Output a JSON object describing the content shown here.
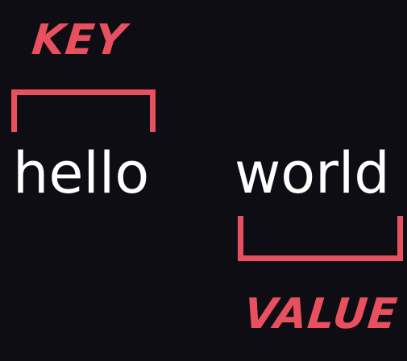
{
  "key_label": "KEY",
  "value_label": "VALUE",
  "key_word": "hello",
  "value_word": "world",
  "colors": {
    "background": "#0e0d14",
    "accent": "#e8505f",
    "text": "#ffffff"
  }
}
